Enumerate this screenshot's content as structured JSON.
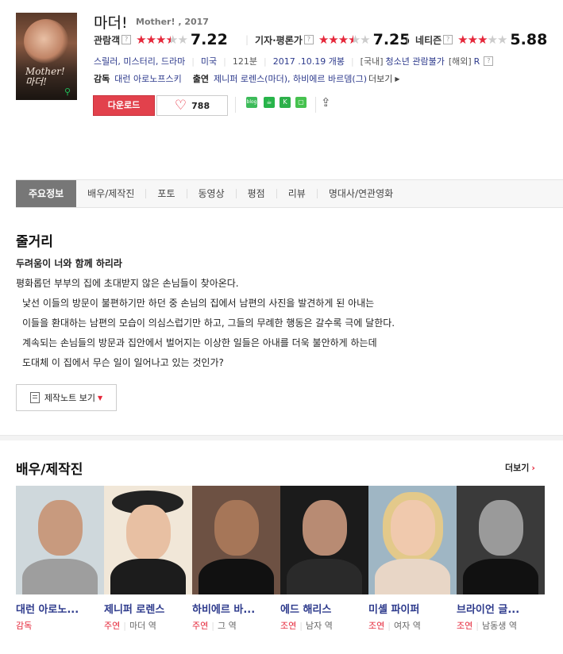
{
  "movie": {
    "title": "마더!",
    "subtitle": "Mother! , 2017",
    "poster_text": "Mother!\n마더!",
    "ratings": [
      {
        "label": "관람객",
        "score": "7.22",
        "stars_filled": 3.5
      },
      {
        "label": "기자·평론가",
        "score": "7.25",
        "stars_filled": 3.5
      },
      {
        "label": "네티즌",
        "score": "5.88",
        "stars_filled": 3
      }
    ],
    "genres": "스릴러, 미스터리, 드라마",
    "country": "미국",
    "runtime": "121분",
    "release": "2017 .10.19 개봉",
    "rating_domestic_label": "[국내]",
    "rating_domestic": "청소년 관람불가",
    "rating_overseas_label": "[해외]",
    "rating_overseas": "R",
    "director_label": "감독",
    "director": "대런 아로노프스키",
    "cast_label": "출연",
    "cast": "제니퍼 로렌스(마더), 하비에르 바르뎀(그)",
    "more_label": "더보기"
  },
  "actions": {
    "download_label": "다운로드",
    "like_count": "788",
    "share_icons": [
      "blog-share-icon",
      "cafe-share-icon",
      "kakaostory-share-icon",
      "band-share-icon"
    ]
  },
  "tabs": [
    "주요정보",
    "배우/제작진",
    "포토",
    "동영상",
    "평점",
    "리뷰",
    "명대사/연관영화"
  ],
  "synopsis": {
    "heading": "줄거리",
    "tagline": "두려움이 너와 함께 하리라",
    "lines": [
      "평화롭던 부부의 집에 초대받지 않은 손님들이 찾아온다.",
      "낯선 이들의 방문이 불편하기만 하던 중 손님의 집에서 남편의 사진을 발견하게 된 아내는",
      "이들을 환대하는 남편의 모습이 의심스럽기만 하고, 그들의 무례한 행동은 갈수록 극에 달한다.",
      "계속되는 손님들의 방문과 집안에서 벌어지는 이상한 일들은 아내를 더욱 불안하게 하는데",
      "도대체 이 집에서 무슨 일이 일어나고 있는 것인가?"
    ],
    "note_button": "제작노트 보기"
  },
  "cast_section": {
    "heading": "배우/제작진",
    "more": "더보기",
    "people": [
      {
        "name": "대런 아로노...",
        "role_type": "감독",
        "role": ""
      },
      {
        "name": "제니퍼 로렌스",
        "role_type": "주연",
        "role": "마더 역"
      },
      {
        "name": "하비에르 바...",
        "role_type": "주연",
        "role": "그 역"
      },
      {
        "name": "에드 해리스",
        "role_type": "조연",
        "role": "남자 역"
      },
      {
        "name": "미셸 파이퍼",
        "role_type": "조연",
        "role": "여자 역"
      },
      {
        "name": "브라이언 글...",
        "role_type": "조연",
        "role": "남동생 역"
      }
    ]
  },
  "colors": {
    "accent": "#e2414c",
    "link": "#2d3a8c",
    "star": "#e5273a"
  }
}
